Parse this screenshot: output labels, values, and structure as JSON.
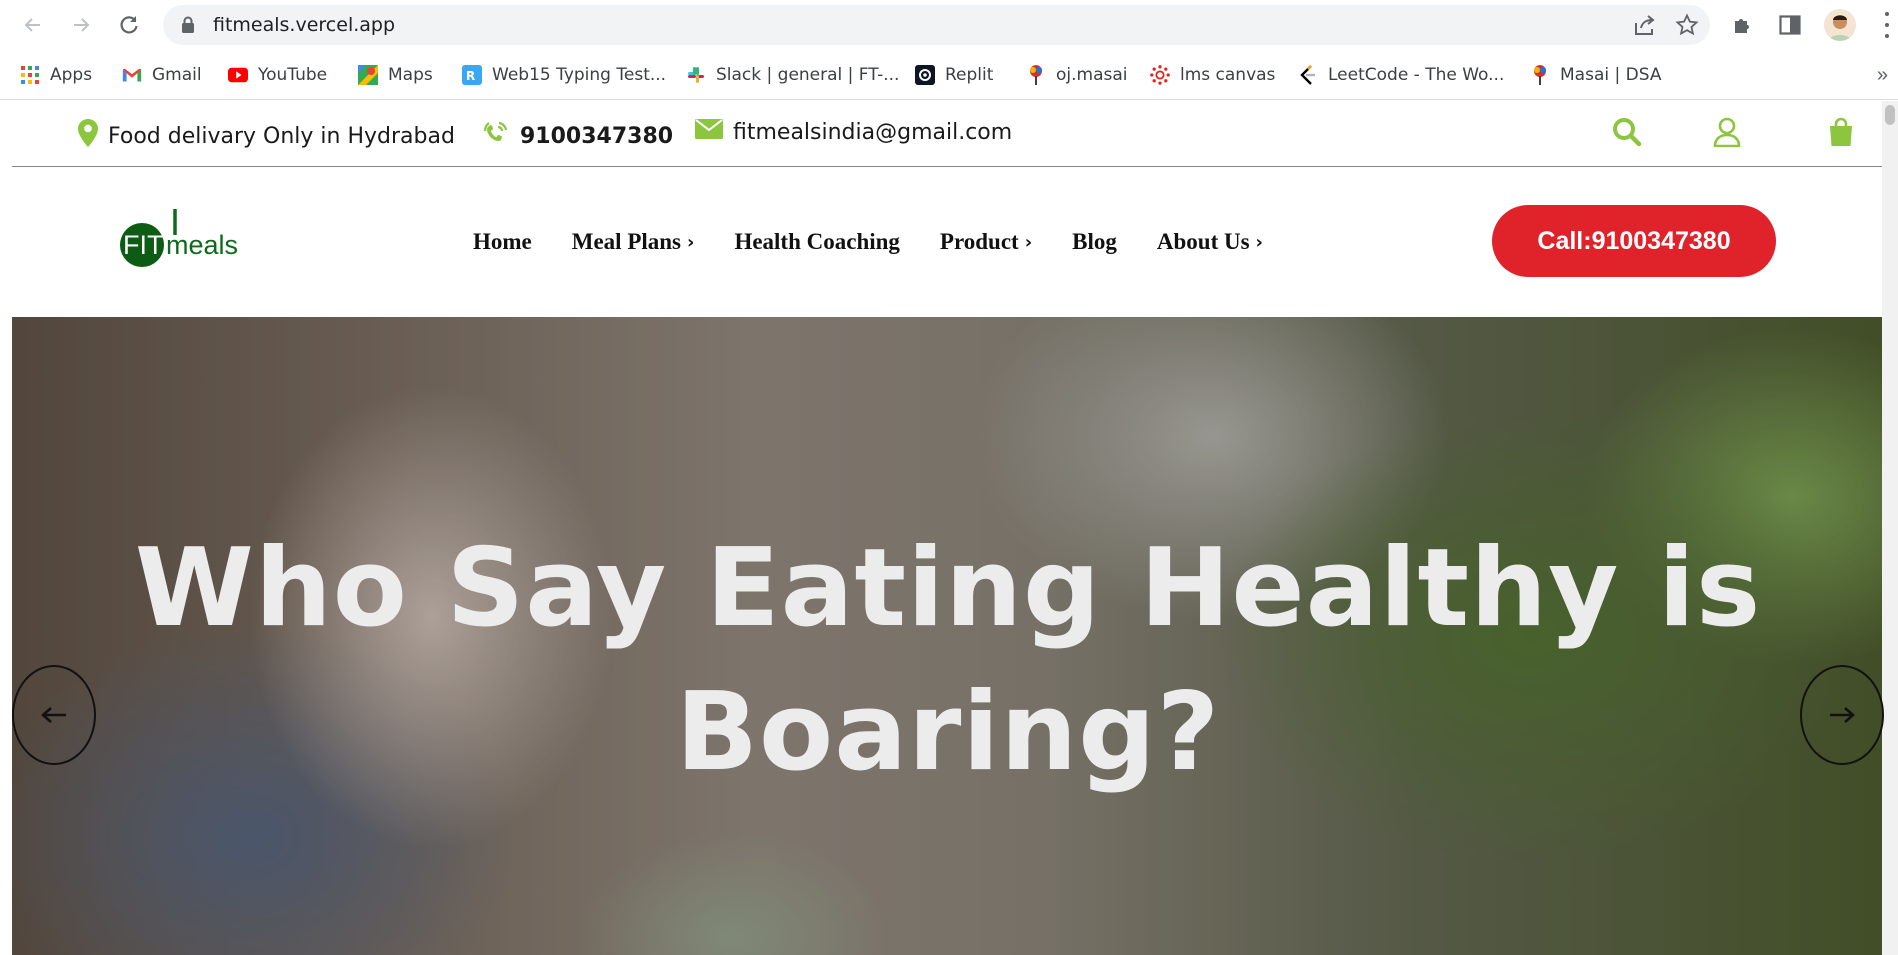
{
  "browser": {
    "url": "fitmeals.vercel.app",
    "bookmarks": [
      {
        "label": "Apps",
        "icon": "apps-grid-icon"
      },
      {
        "label": "Gmail",
        "icon": "gmail-icon"
      },
      {
        "label": "YouTube",
        "icon": "youtube-icon"
      },
      {
        "label": "Maps",
        "icon": "maps-icon"
      },
      {
        "label": "Web15 Typing Test...",
        "icon": "typing-test-icon"
      },
      {
        "label": "Slack | general | FT-...",
        "icon": "slack-icon"
      },
      {
        "label": "Replit",
        "icon": "replit-icon"
      },
      {
        "label": "oj.masai",
        "icon": "masai-icon"
      },
      {
        "label": "lms canvas",
        "icon": "canvas-icon"
      },
      {
        "label": "LeetCode - The Wo...",
        "icon": "leetcode-icon"
      },
      {
        "label": "Masai | DSA",
        "icon": "masai-icon"
      }
    ],
    "more_glyph": "»"
  },
  "topbar": {
    "location": "Food delivary Only in Hydrabad",
    "phone": "9100347380",
    "email": "fitmealsindia@gmail.com"
  },
  "header": {
    "logo_text_fit": "FIT",
    "logo_text_meals": "meals",
    "menu": [
      {
        "label": "Home",
        "has_submenu": false
      },
      {
        "label": "Meal Plans",
        "has_submenu": true
      },
      {
        "label": "Health Coaching",
        "has_submenu": false
      },
      {
        "label": "Product",
        "has_submenu": true
      },
      {
        "label": "Blog",
        "has_submenu": false
      },
      {
        "label": "About Us",
        "has_submenu": true
      }
    ],
    "call_button": "Call:9100347380"
  },
  "hero": {
    "title": "Who Say Eating Healthy is Boaring?"
  },
  "colors": {
    "accent_green": "#8cc63f",
    "call_red": "#e0232b",
    "logo_green": "#0d6b1e"
  }
}
